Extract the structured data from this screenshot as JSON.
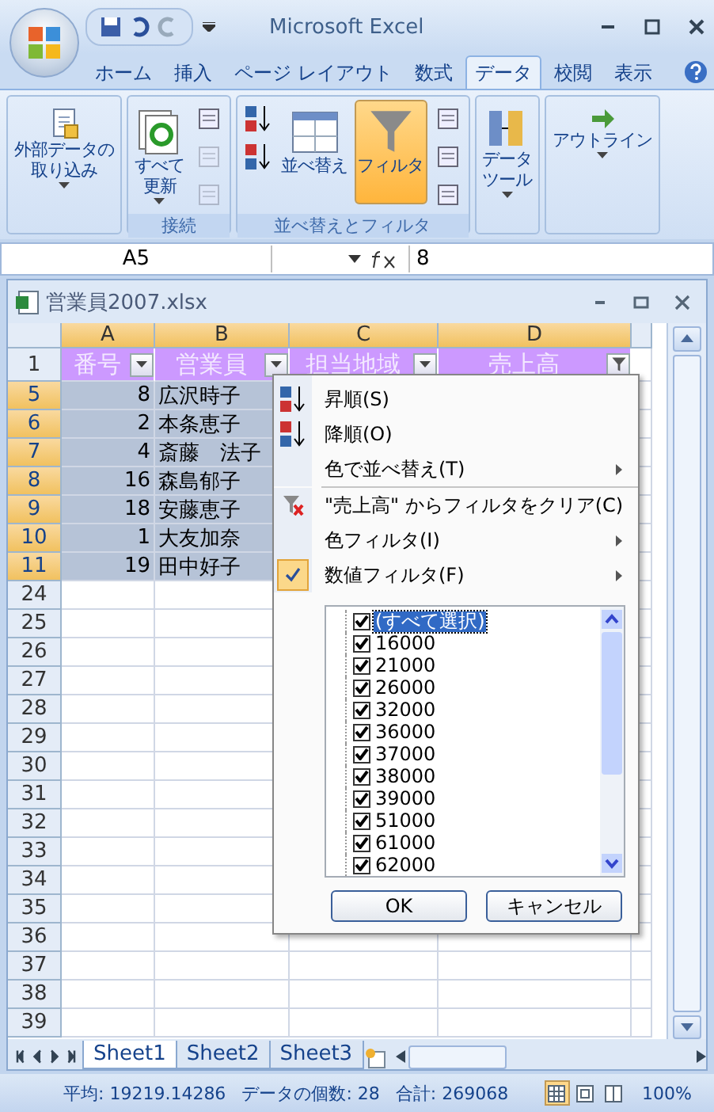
{
  "window": {
    "title": "Microsoft Excel"
  },
  "ribbon_tabs": [
    {
      "label": "ホーム",
      "selected": false
    },
    {
      "label": "挿入",
      "selected": false
    },
    {
      "label": "ページ レイアウト",
      "selected": false
    },
    {
      "label": "数式",
      "selected": false
    },
    {
      "label": "データ",
      "selected": true
    },
    {
      "label": "校閲",
      "selected": false
    },
    {
      "label": "表示",
      "selected": false
    }
  ],
  "ribbon_groups": [
    {
      "items": [
        {
          "kind": "large",
          "label_lines": [
            "外部データの",
            "取り込み"
          ],
          "dropdown": true,
          "selected": false
        }
      ]
    },
    {
      "label": "接続",
      "items": [
        {
          "kind": "large",
          "label_lines": [
            "すべて",
            "更新"
          ],
          "dropdown": true,
          "selected": false
        },
        {
          "kind": "small",
          "disabled": false
        },
        {
          "kind": "small",
          "disabled": true
        },
        {
          "kind": "small",
          "disabled": true
        }
      ]
    },
    {
      "label": "並べ替えとフィルタ",
      "items": [
        {
          "kind": "small",
          "disabled": false
        },
        {
          "kind": "small",
          "disabled": false
        },
        {
          "kind": "large",
          "label_lines": [
            "並べ替え"
          ],
          "dropdown": false,
          "selected": false
        },
        {
          "kind": "large",
          "label_lines": [
            "フィルタ"
          ],
          "dropdown": false,
          "selected": true
        },
        {
          "kind": "small",
          "disabled": false
        },
        {
          "kind": "small",
          "disabled": false
        },
        {
          "kind": "small",
          "disabled": false
        }
      ]
    },
    {
      "items": [
        {
          "kind": "large",
          "label_lines": [
            "データ",
            "ツール"
          ],
          "dropdown": true,
          "selected": false
        }
      ]
    },
    {
      "items": [
        {
          "kind": "large",
          "label_lines": [
            "アウトライン"
          ],
          "dropdown": true,
          "selected": false
        }
      ]
    }
  ],
  "formula_bar": {
    "name_box": "A5",
    "value": "8"
  },
  "workbook": {
    "title": "営業員2007.xlsx",
    "columns": [
      {
        "label": "A",
        "selected": true
      },
      {
        "label": "B",
        "selected": true
      },
      {
        "label": "C",
        "selected": true
      },
      {
        "label": "D",
        "selected": true
      }
    ],
    "header_row": {
      "number": "1",
      "cells": [
        {
          "text": "番号",
          "filter_applied": false
        },
        {
          "text": "営業員",
          "filter_applied": false
        },
        {
          "text": "担当地域",
          "filter_applied": false
        },
        {
          "text": "売上高",
          "filter_applied": true
        }
      ]
    },
    "rows": [
      {
        "number": "5",
        "selected": true,
        "cells": [
          "8",
          "広沢時子"
        ]
      },
      {
        "number": "6",
        "selected": true,
        "cells": [
          "2",
          "本条恵子"
        ]
      },
      {
        "number": "7",
        "selected": true,
        "cells": [
          "4",
          "斎藤　法子"
        ]
      },
      {
        "number": "8",
        "selected": true,
        "cells": [
          "16",
          "森島郁子"
        ]
      },
      {
        "number": "9",
        "selected": true,
        "cells": [
          "18",
          "安藤恵子"
        ]
      },
      {
        "number": "10",
        "selected": true,
        "cells": [
          "1",
          "大友加奈"
        ]
      },
      {
        "number": "11",
        "selected": true,
        "cells": [
          "19",
          "田中好子"
        ]
      },
      {
        "number": "24",
        "selected": false,
        "cells": []
      },
      {
        "number": "25",
        "selected": false,
        "cells": []
      },
      {
        "number": "26",
        "selected": false,
        "cells": []
      },
      {
        "number": "27",
        "selected": false,
        "cells": []
      },
      {
        "number": "28",
        "selected": false,
        "cells": []
      },
      {
        "number": "29",
        "selected": false,
        "cells": []
      },
      {
        "number": "30",
        "selected": false,
        "cells": []
      },
      {
        "number": "31",
        "selected": false,
        "cells": []
      },
      {
        "number": "32",
        "selected": false,
        "cells": []
      },
      {
        "number": "33",
        "selected": false,
        "cells": []
      },
      {
        "number": "34",
        "selected": false,
        "cells": []
      },
      {
        "number": "35",
        "selected": false,
        "cells": []
      },
      {
        "number": "36",
        "selected": false,
        "cells": []
      },
      {
        "number": "37",
        "selected": false,
        "cells": []
      },
      {
        "number": "38",
        "selected": false,
        "cells": []
      },
      {
        "number": "39",
        "selected": false,
        "cells": []
      }
    ],
    "sheet_tabs": [
      {
        "label": "Sheet1",
        "selected": true
      },
      {
        "label": "Sheet2",
        "selected": false
      },
      {
        "label": "Sheet3",
        "selected": false
      }
    ]
  },
  "filter_menu": {
    "items": [
      {
        "kind": "sort_asc",
        "label": "昇順(S)",
        "submenu": false,
        "checked": false
      },
      {
        "kind": "sort_desc",
        "label": "降順(O)",
        "submenu": false,
        "checked": false
      },
      {
        "kind": "plain",
        "label": "色で並べ替え(T)",
        "submenu": true,
        "checked": false
      },
      {
        "kind": "separator"
      },
      {
        "kind": "clear",
        "label": "\"売上高\" からフィルタをクリア(C)",
        "submenu": false,
        "checked": false
      },
      {
        "kind": "plain",
        "label": "色フィルタ(I)",
        "submenu": true,
        "checked": false
      },
      {
        "kind": "plain",
        "label": "数値フィルタ(F)",
        "submenu": true,
        "checked": true
      }
    ],
    "values": [
      {
        "label": "(すべて選択)",
        "checked": true,
        "selected": true
      },
      {
        "label": "16000",
        "checked": true,
        "selected": false
      },
      {
        "label": "21000",
        "checked": true,
        "selected": false
      },
      {
        "label": "26000",
        "checked": true,
        "selected": false
      },
      {
        "label": "32000",
        "checked": true,
        "selected": false
      },
      {
        "label": "36000",
        "checked": true,
        "selected": false
      },
      {
        "label": "37000",
        "checked": true,
        "selected": false
      },
      {
        "label": "38000",
        "checked": true,
        "selected": false
      },
      {
        "label": "39000",
        "checked": true,
        "selected": false
      },
      {
        "label": "51000",
        "checked": true,
        "selected": false
      },
      {
        "label": "61000",
        "checked": true,
        "selected": false
      },
      {
        "label": "62000",
        "checked": true,
        "selected": false
      }
    ],
    "buttons": [
      "OK",
      "キャンセル"
    ]
  },
  "status_bar": {
    "items": [
      "平均: 19219.14286",
      "データの個数: 28",
      "合計: 269068"
    ],
    "views": [
      {
        "selected": true
      },
      {
        "selected": false
      },
      {
        "selected": false
      }
    ],
    "zoom": "100%"
  }
}
